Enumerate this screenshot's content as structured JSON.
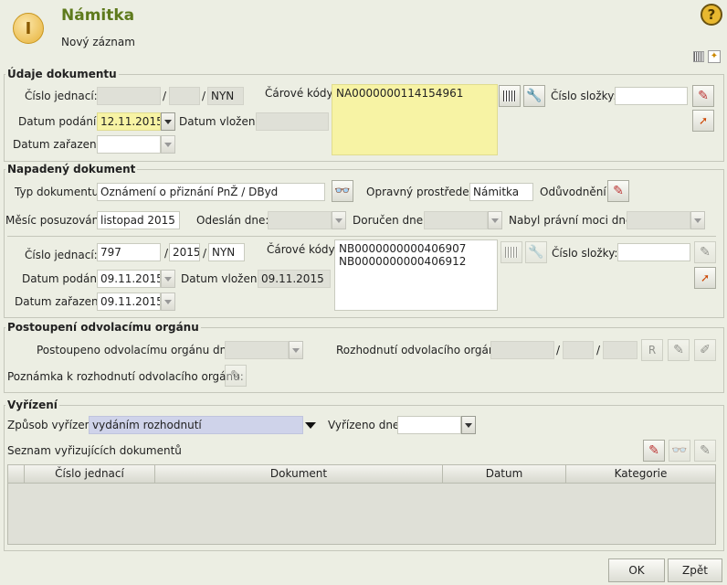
{
  "header": {
    "title": "Námitka",
    "subtitle": "Nový záznam"
  },
  "udaje": {
    "legend": "Údaje dokumentu",
    "cislo_jednaci_label": "Číslo jednací:",
    "cj_sep1": "/",
    "cj_sep2": "/",
    "cj_suffix": "NYN",
    "carove_kody_label": "Čárové kódy:",
    "carove_kody_value": "NA0000000114154961",
    "cislo_slozky_label": "Číslo složky:",
    "datum_podani_label": "Datum podání:",
    "datum_podani_value": "12.11.2015",
    "datum_vlozeni_label": "Datum vložení:",
    "datum_zarazeni_label": "Datum zařazení:"
  },
  "napadeny": {
    "legend": "Napadený dokument",
    "typ_label": "Typ dokumentu:",
    "typ_value": "Oznámení o přiznání PnŽ / DByd",
    "opravny_label": "Opravný prostředek:",
    "opravny_value": "Námitka",
    "oduvodneni_label": "Odůvodnění:",
    "mesic_label": "Měsíc posuzování:",
    "mesic_value": "listopad 2015",
    "odeslan_label": "Odeslán dne:",
    "dorucen_label": "Doručen dne:",
    "nabyl_label": "Nabyl právní moci dne:",
    "cislo_jednaci_label": "Číslo jednací:",
    "cj_num": "797",
    "cj_sep1": "/",
    "cj_year": "2015",
    "cj_sep2": "/",
    "cj_suffix": "NYN",
    "carove_kody_label": "Čárové kódy:",
    "carove_kody_line1": "NB0000000000406907",
    "carove_kody_line2": "NB0000000000406912",
    "cislo_slozky_label": "Číslo složky:",
    "datum_podani_label": "Datum podání:",
    "datum_podani_value": "09.11.2015",
    "datum_vlozeni_label": "Datum vložení:",
    "datum_vlozeni_value": "09.11.2015",
    "datum_zarazeni_label": "Datum zařazení:",
    "datum_zarazeni_value": "09.11.2015"
  },
  "postoupeni": {
    "legend": "Postoupení odvolacímu orgánu",
    "postoupeno_label": "Postoupeno odvolacímu orgánu dne:",
    "rozhodnuti_label": "Rozhodnutí odvolacího orgánu",
    "sep1": "/",
    "sep2": "/",
    "r_button": "R",
    "poznamka_label": "Poznámka k rozhodnutí odvolacího orgánu:"
  },
  "vyrizeni": {
    "legend": "Vyřízení",
    "zpusob_label": "Způsob vyřízení:",
    "zpusob_value": "vydáním rozhodnutí",
    "vyrizeno_label": "Vyřízeno dne:",
    "seznam_label": "Seznam vyřizujících dokumentů",
    "columns": [
      "Číslo jednací",
      "Dokument",
      "Datum",
      "Kategorie"
    ]
  },
  "footer": {
    "ok": "OK",
    "zpet": "Zpět"
  }
}
